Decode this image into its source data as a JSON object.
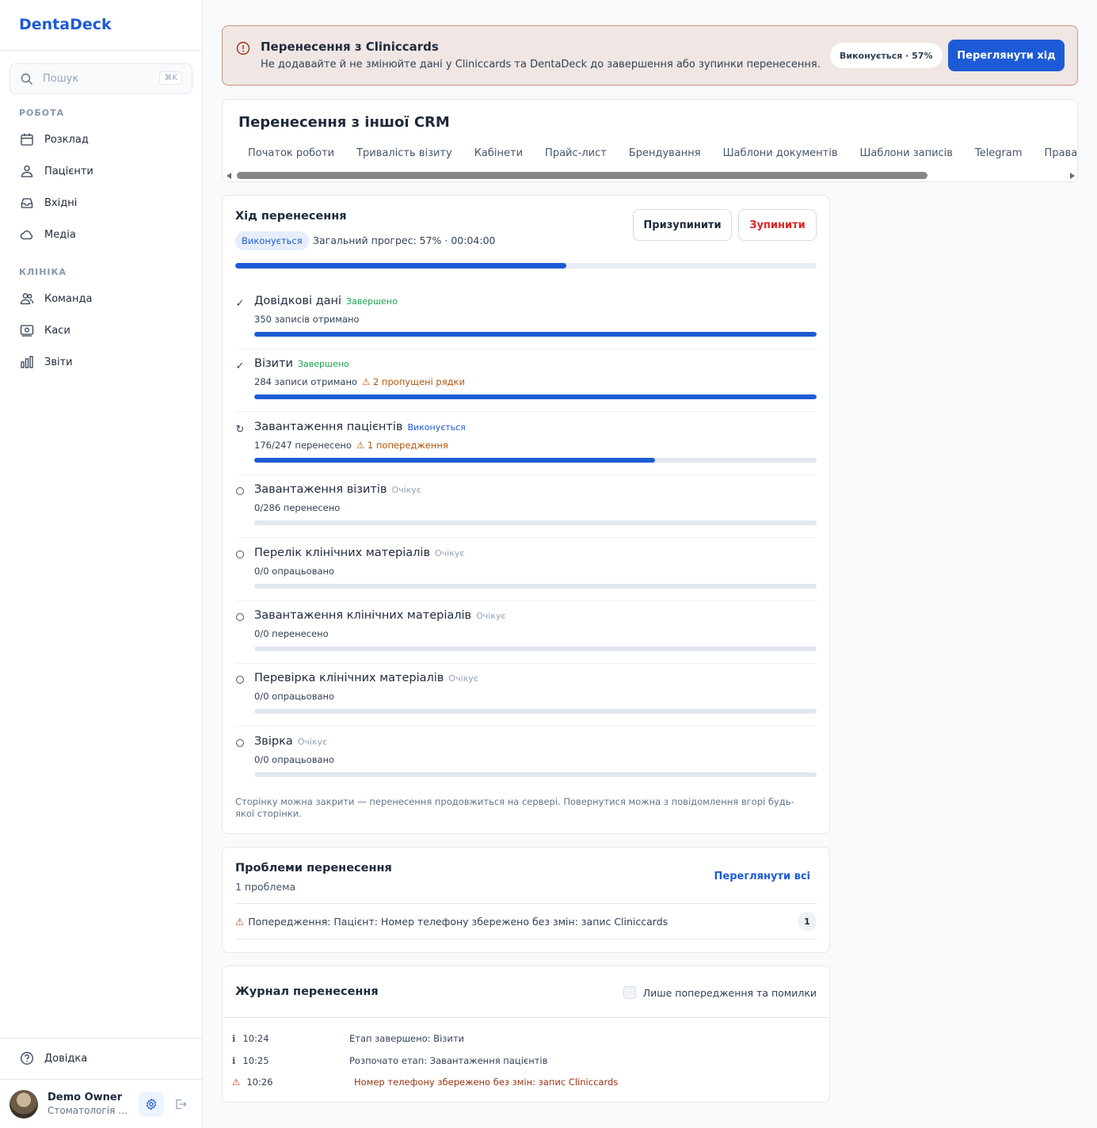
{
  "app": {
    "name": "DentaDeck"
  },
  "search": {
    "placeholder": "Пошук",
    "shortcut": "⌘K"
  },
  "sidebar": {
    "sections": [
      {
        "title": "РОБОТА",
        "items": [
          {
            "label": "Розклад",
            "icon": "calendar-icon"
          },
          {
            "label": "Пацієнти",
            "icon": "users-icon"
          },
          {
            "label": "Вхідні",
            "icon": "inbox-icon"
          },
          {
            "label": "Медіа",
            "icon": "cloud-icon"
          }
        ]
      },
      {
        "title": "КЛІНІКА",
        "items": [
          {
            "label": "Команда",
            "icon": "team-icon"
          },
          {
            "label": "Каси",
            "icon": "cash-register-icon"
          },
          {
            "label": "Звіти",
            "icon": "bar-chart-icon"
          }
        ]
      }
    ],
    "help": "Довідка",
    "user": {
      "name": "Demo Owner",
      "clinic": "Стоматологія П..."
    }
  },
  "banner": {
    "title": "Перенесення з Cliniccards",
    "message": "Не додавайте й не змінюйте дані у Cliniccards та DentaDeck до завершення або зупинки перенесення.",
    "status": "Виконується · 57%",
    "button": "Переглянути хід"
  },
  "header": {
    "title": "Перенесення з іншої CRM",
    "tabs": [
      "Початок роботи",
      "Тривалість візиту",
      "Кабінети",
      "Прайс-лист",
      "Брендування",
      "Шаблони документів",
      "Шаблони записів",
      "Telegram",
      "Права доступу"
    ]
  },
  "progress": {
    "title": "Хід перенесення",
    "status": "Виконується",
    "summary": "Загальний прогрес: 57% · 00:04:00",
    "percent": 57,
    "pause": "Призупинити",
    "stop": "Зупинити",
    "steps": [
      {
        "name": "Довідкові дані",
        "status": "Завершено",
        "state": "done",
        "detail": "350 записів отримано",
        "warning": "",
        "fraction": 1.0
      },
      {
        "name": "Візити",
        "status": "Завершено",
        "state": "done",
        "detail": "284 записи отримано",
        "warning": "⚠ 2 пропущені рядки",
        "fraction": 1.0
      },
      {
        "name": "Завантаження пацієнтів",
        "status": "Виконується",
        "state": "running",
        "detail": "176/247 перенесено",
        "warning": "⚠ 1 попередження",
        "fraction": 0.7126
      },
      {
        "name": "Завантаження візитів",
        "status": "Очікує",
        "state": "pending",
        "detail": "0/286 перенесено",
        "warning": "",
        "fraction": 0
      },
      {
        "name": "Перелік клінічних матеріалів",
        "status": "Очікує",
        "state": "pending",
        "detail": "0/0 опрацьовано",
        "warning": "",
        "fraction": 0
      },
      {
        "name": "Завантаження клінічних матеріалів",
        "status": "Очікує",
        "state": "pending",
        "detail": "0/0 перенесено",
        "warning": "",
        "fraction": 0
      },
      {
        "name": "Перевірка клінічних матеріалів",
        "status": "Очікує",
        "state": "pending",
        "detail": "0/0 опрацьовано",
        "warning": "",
        "fraction": 0
      },
      {
        "name": "Звірка",
        "status": "Очікує",
        "state": "pending",
        "detail": "0/0 опрацьовано",
        "warning": "",
        "fraction": 0
      }
    ],
    "note": "Сторінку можна закрити — перенесення продовжиться на сервері. Повернутися можна з повідомлення вгорі будь-якої сторінки."
  },
  "problems": {
    "title": "Проблеми перенесення",
    "count_text": "1 проблема",
    "view_all": "Переглянути всі",
    "items": [
      {
        "text": "Попередження: Пацієнт: Номер телефону збережено без змін: запис Cliniccards",
        "count": "1"
      }
    ]
  },
  "log": {
    "title": "Журнал перенесення",
    "filter_label": "Лише попередження та помилки",
    "entries": [
      {
        "level": "info",
        "time": "10:24",
        "message": "Етап завершено: Візити"
      },
      {
        "level": "info",
        "time": "10:25",
        "message": "Розпочато етап: Завантаження пацієнтів"
      },
      {
        "level": "warning",
        "time": "10:26",
        "message": "Номер телефону збережено без змін: запис Cliniccards"
      }
    ]
  },
  "colors": {
    "accent": "#1d5bd6",
    "success": "#16a34a",
    "danger": "#dc2626",
    "warning": "#b45309",
    "banner_bg": "#f0e6e3"
  }
}
